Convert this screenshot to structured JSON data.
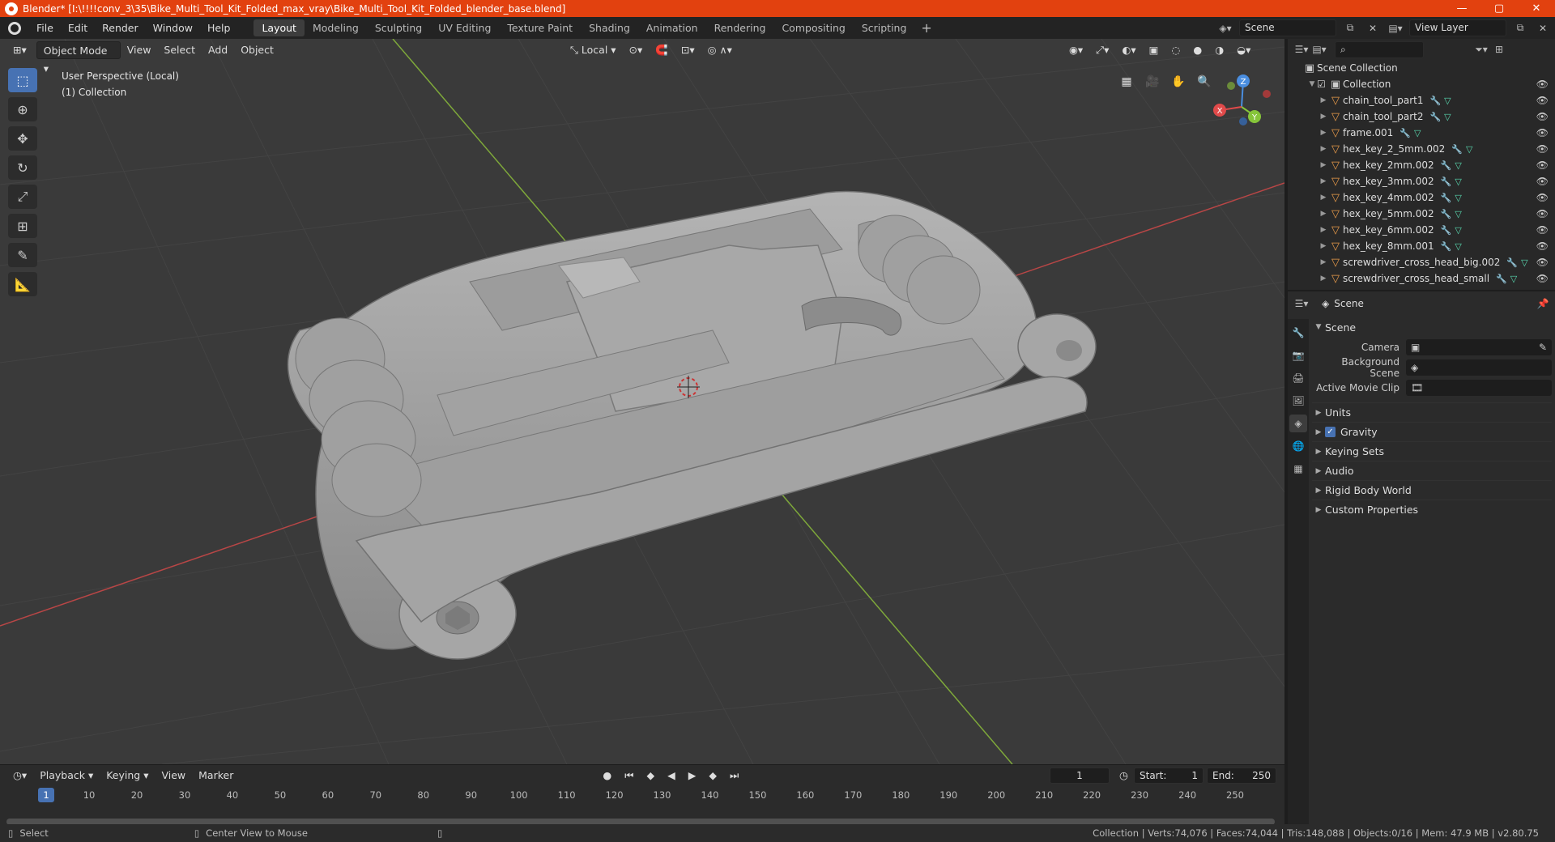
{
  "window": {
    "title": "Blender* [I:\\!!!!conv_3\\35\\Bike_Multi_Tool_Kit_Folded_max_vray\\Bike_Multi_Tool_Kit_Folded_blender_base.blend]",
    "minimize": "—",
    "maximize": "▢",
    "close": "✕"
  },
  "menu": {
    "file": "File",
    "edit": "Edit",
    "render": "Render",
    "window": "Window",
    "help": "Help"
  },
  "workspaces": [
    "Layout",
    "Modeling",
    "Sculpting",
    "UV Editing",
    "Texture Paint",
    "Shading",
    "Animation",
    "Rendering",
    "Compositing",
    "Scripting"
  ],
  "active_workspace": "Layout",
  "scene_field": "Scene",
  "view_layer_field": "View Layer",
  "viewport": {
    "mode": "Object Mode",
    "menus": {
      "view": "View",
      "select": "Select",
      "add": "Add",
      "object": "Object"
    },
    "orientation": "Local",
    "info_line1": "User Perspective (Local)",
    "info_line2": "(1) Collection",
    "gizmo": {
      "x": "X",
      "y": "Y",
      "z": "Z"
    }
  },
  "outliner": {
    "root": "Scene Collection",
    "collection": "Collection",
    "items": [
      "chain_tool_part1",
      "chain_tool_part2",
      "frame.001",
      "hex_key_2_5mm.002",
      "hex_key_2mm.002",
      "hex_key_3mm.002",
      "hex_key_4mm.002",
      "hex_key_5mm.002",
      "hex_key_6mm.002",
      "hex_key_8mm.001",
      "screwdriver_cross_head_big.002",
      "screwdriver_cross_head_small"
    ]
  },
  "properties": {
    "header": "Scene",
    "panel": "Scene",
    "camera_label": "Camera",
    "background_scene_label": "Background Scene",
    "active_movie_clip_label": "Active Movie Clip",
    "subpanels": {
      "units": "Units",
      "gravity": "Gravity",
      "keying_sets": "Keying Sets",
      "audio": "Audio",
      "rigid_body_world": "Rigid Body World",
      "custom_properties": "Custom Properties"
    },
    "gravity_checked": true
  },
  "timeline": {
    "menus": {
      "playback": "Playback",
      "keying": "Keying",
      "view": "View",
      "marker": "Marker"
    },
    "current_frame": "1",
    "start_label": "Start:",
    "start": "1",
    "end_label": "End:",
    "end": "250",
    "ruler": [
      "1",
      "10",
      "20",
      "30",
      "40",
      "50",
      "60",
      "70",
      "80",
      "90",
      "100",
      "110",
      "120",
      "130",
      "140",
      "150",
      "160",
      "170",
      "180",
      "190",
      "200",
      "210",
      "220",
      "230",
      "240",
      "250"
    ]
  },
  "status": {
    "select": "Select",
    "center_view": "Center View to Mouse",
    "stats": "Collection | Verts:74,076 | Faces:74,044 | Tris:148,088 | Objects:0/16 | Mem: 47.9 MB | v2.80.75"
  },
  "colors": {
    "title_bar": "#e2410f",
    "accent": "#4772b3",
    "x_axis": "#e04a4a",
    "y_axis": "#86c53a",
    "z_axis": "#4a8ee0"
  }
}
